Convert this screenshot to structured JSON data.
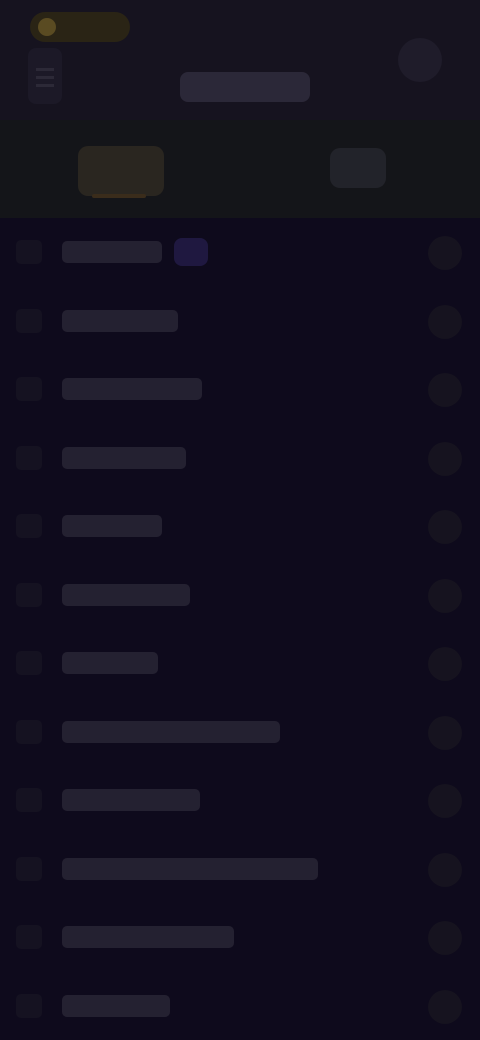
{
  "header": {
    "title": "",
    "logo": "app-logo",
    "menu_icon": "menu-icon",
    "action_icon": "profile-icon"
  },
  "tabs": {
    "active": "",
    "secondary": ""
  },
  "list": {
    "rows": [
      {
        "index": "",
        "label": "",
        "badge": true
      },
      {
        "index": "",
        "label": ""
      },
      {
        "index": "",
        "label": ""
      },
      {
        "index": "",
        "label": ""
      },
      {
        "index": "",
        "label": ""
      },
      {
        "index": "",
        "label": ""
      },
      {
        "index": "",
        "label": ""
      },
      {
        "index": "",
        "label": ""
      },
      {
        "index": "",
        "label": ""
      },
      {
        "index": "",
        "label": ""
      },
      {
        "index": "",
        "label": ""
      },
      {
        "index": "",
        "label": ""
      }
    ]
  },
  "colors": {
    "background": "#0e0a1c",
    "header": "#16131f",
    "accent": "#3a2c1b",
    "badge": "#1f1840"
  }
}
